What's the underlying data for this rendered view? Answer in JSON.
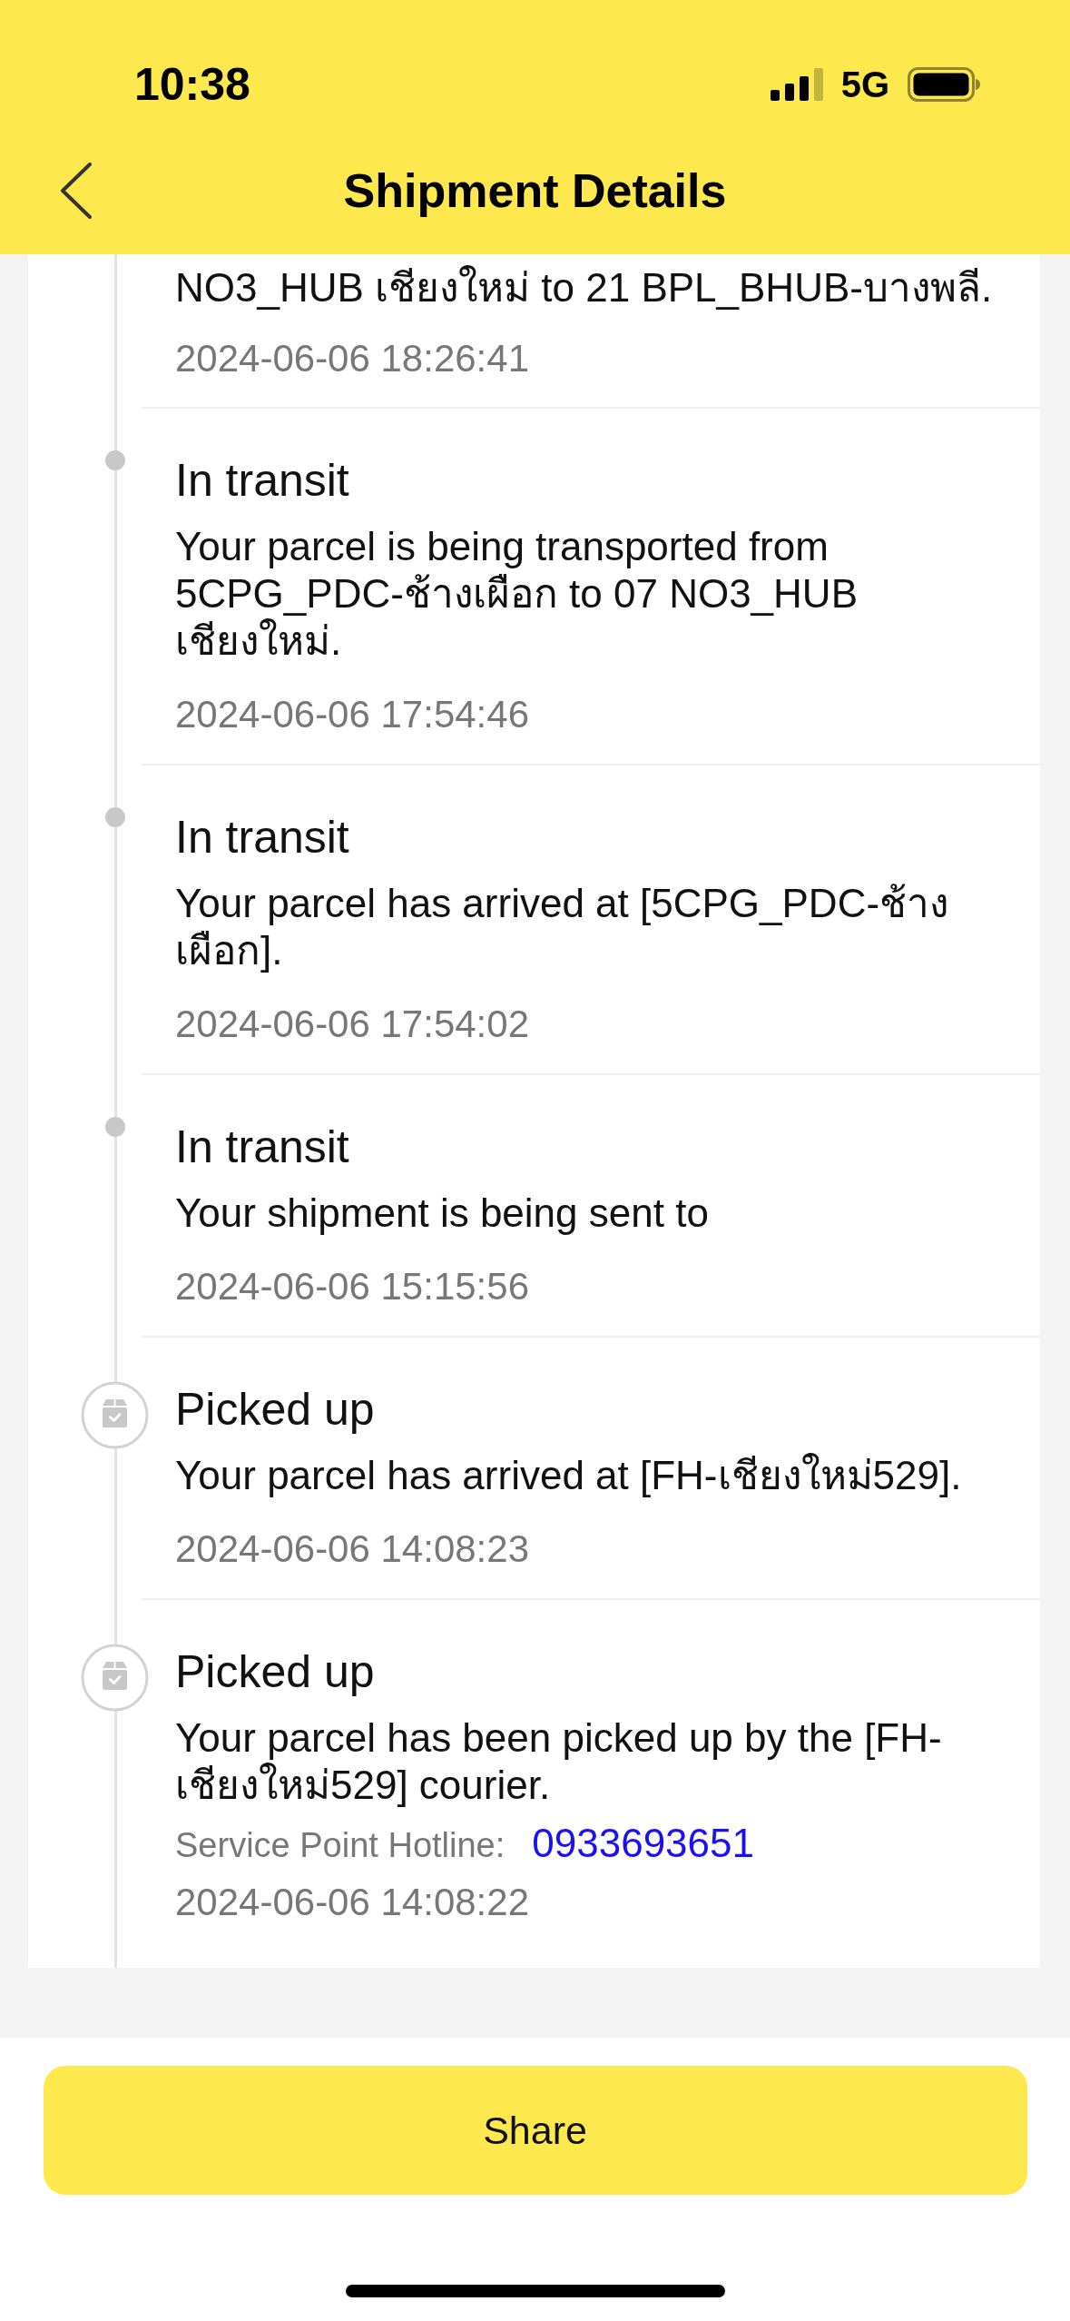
{
  "status_bar": {
    "time": "10:38",
    "network": "5G"
  },
  "nav_bar": {
    "title": "Shipment Details"
  },
  "events": [
    {
      "kind": "partial",
      "description": "NO3_HUB เชียงใหม่ to 21 BPL_BHUB-บางพลี.",
      "timestamp": "2024-06-06 18:26:41"
    },
    {
      "kind": "transit",
      "status": "In transit",
      "description": "Your parcel is being transported from 5CPG_PDC-ช้างเผือก to 07 NO3_HUB เชียงใหม่.",
      "timestamp": "2024-06-06 17:54:46"
    },
    {
      "kind": "transit",
      "status": "In transit",
      "description": "Your parcel has arrived at [5CPG_PDC-ช้างเผือก].",
      "timestamp": "2024-06-06 17:54:02"
    },
    {
      "kind": "transit",
      "status": "In transit",
      "description": "Your shipment is being sent to",
      "timestamp": "2024-06-06 15:15:56"
    },
    {
      "kind": "pickup",
      "status": "Picked up",
      "description": "Your parcel has arrived at [FH-เชียงใหม่529].",
      "timestamp": "2024-06-06 14:08:23"
    },
    {
      "kind": "pickup",
      "status": "Picked up",
      "description": "Your parcel has been picked up by the [FH-เชียงใหม่529] courier.",
      "hotline": {
        "label": "Service Point Hotline:",
        "number": "0933693651"
      },
      "timestamp": "2024-06-06 14:08:22"
    }
  ],
  "share_button": {
    "label": "Share"
  }
}
